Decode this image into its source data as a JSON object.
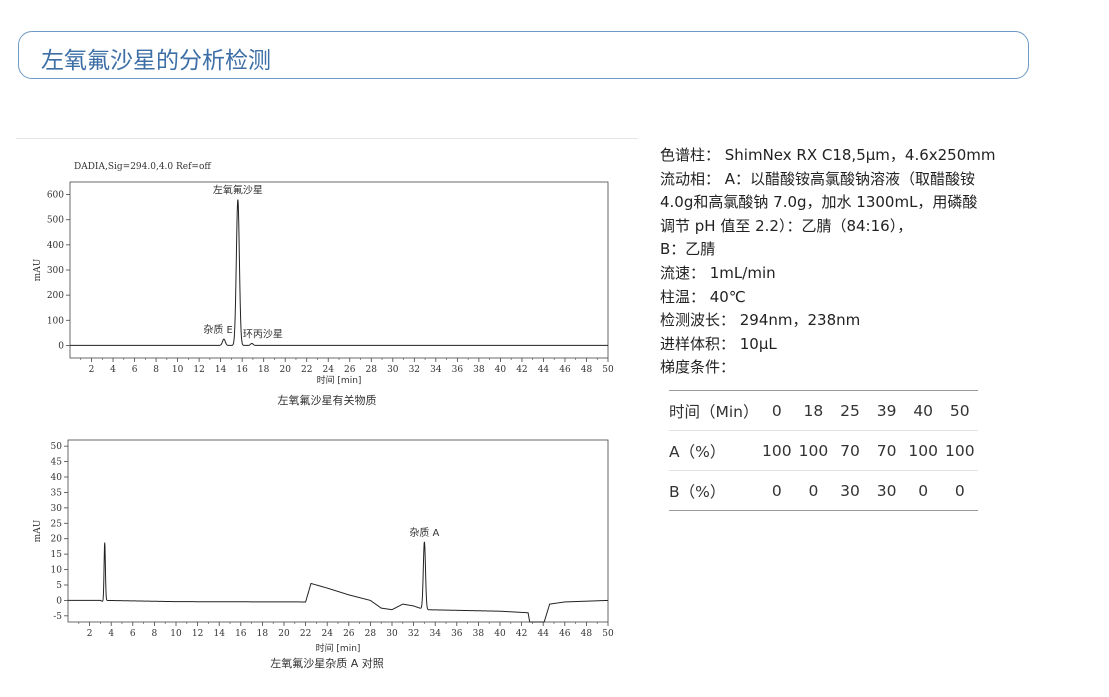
{
  "page": {
    "title": "左氧氟沙星的分析检测"
  },
  "charts": [
    {
      "header": "DADIA,Sig=294.0,4.0  Ref=off",
      "ylabel": "mAU",
      "xlabel": "时间 [min]",
      "caption": "左氧氟沙星有关物质"
    },
    {
      "header": "",
      "ylabel": "mAU",
      "xlabel": "时间 [min]",
      "caption": "左氧氟沙星杂质 A 对照"
    }
  ],
  "chart_data": [
    {
      "type": "line",
      "title": "DADIA,Sig=294.0,4.0  Ref=off",
      "xlabel": "时间 [min]",
      "ylabel": "mAU",
      "xlim": [
        0,
        50
      ],
      "ylim": [
        -50,
        650
      ],
      "xticks": [
        2,
        4,
        6,
        8,
        10,
        12,
        14,
        16,
        18,
        20,
        22,
        24,
        26,
        28,
        30,
        32,
        34,
        36,
        38,
        40,
        42,
        44,
        46,
        48,
        50
      ],
      "yticks": [
        0,
        100,
        200,
        300,
        400,
        500,
        600
      ],
      "baseline": 0,
      "peaks": [
        {
          "label": "杂质 E",
          "x": 14.3,
          "height": 25,
          "width": 0.13
        },
        {
          "label": "左氧氟沙星",
          "x": 15.6,
          "height": 580,
          "width": 0.14
        },
        {
          "label": "环丙沙星",
          "x": 16.9,
          "height": 8,
          "width": 0.12
        }
      ],
      "caption": "左氧氟沙星有关物质"
    },
    {
      "type": "line",
      "title": "",
      "xlabel": "时间 [min]",
      "ylabel": "mAU",
      "xlim": [
        0,
        50
      ],
      "ylim": [
        -7,
        52
      ],
      "xticks": [
        2,
        4,
        6,
        8,
        10,
        12,
        14,
        16,
        18,
        20,
        22,
        24,
        26,
        28,
        30,
        32,
        34,
        36,
        38,
        40,
        42,
        44,
        46,
        48,
        50
      ],
      "yticks": [
        -5,
        0,
        5,
        10,
        15,
        20,
        25,
        30,
        35,
        40,
        45,
        50
      ],
      "baseline_points": [
        [
          0,
          0
        ],
        [
          3.0,
          0
        ],
        [
          3.3,
          -0.5
        ],
        [
          3.5,
          0
        ],
        [
          10,
          -0.4
        ],
        [
          22.0,
          -0.5
        ],
        [
          22.5,
          5.5
        ],
        [
          24,
          4
        ],
        [
          26,
          1.8
        ],
        [
          28,
          0
        ],
        [
          29,
          -2.5
        ],
        [
          30,
          -3
        ],
        [
          31,
          -1.2
        ],
        [
          32,
          -1.8
        ],
        [
          33,
          -3
        ],
        [
          40,
          -3.5
        ],
        [
          42.6,
          -4
        ],
        [
          42.8,
          -8
        ],
        [
          44.0,
          -8
        ],
        [
          44.6,
          -1.2
        ],
        [
          46,
          -0.5
        ],
        [
          50,
          0
        ]
      ],
      "peaks": [
        {
          "label": "",
          "x": 3.4,
          "height": 19,
          "width": 0.06
        },
        {
          "label": "杂质 A",
          "x": 33.0,
          "height": 22,
          "width": 0.1
        }
      ],
      "caption": "左氧氟沙星杂质 A 对照"
    }
  ],
  "conditions": {
    "lines": [
      "色谱柱： ShimNex RX C18,5μm，4.6x250mm",
      "流动相： A：以醋酸铵高氯酸钠溶液（取醋酸铵",
      "4.0g和高氯酸钠 7.0g，加水 1300mL，用磷酸",
      "调节 pH 值至 2.2）：乙腈（84:16），",
      "B：乙腈",
      "流速： 1mL/min",
      "柱温： 40℃",
      "检测波长： 294nm，238nm",
      "进样体积： 10μL",
      "梯度条件："
    ]
  },
  "gradient_table": {
    "rows": [
      {
        "label": "时间（Min）",
        "cells": [
          "0",
          "18",
          "25",
          "39",
          "40",
          "50"
        ]
      },
      {
        "label": "A（%）",
        "cells": [
          "100",
          "100",
          "70",
          "70",
          "100",
          "100"
        ]
      },
      {
        "label": "B（%）",
        "cells": [
          "0",
          "0",
          "30",
          "30",
          "0",
          "0"
        ]
      }
    ]
  }
}
